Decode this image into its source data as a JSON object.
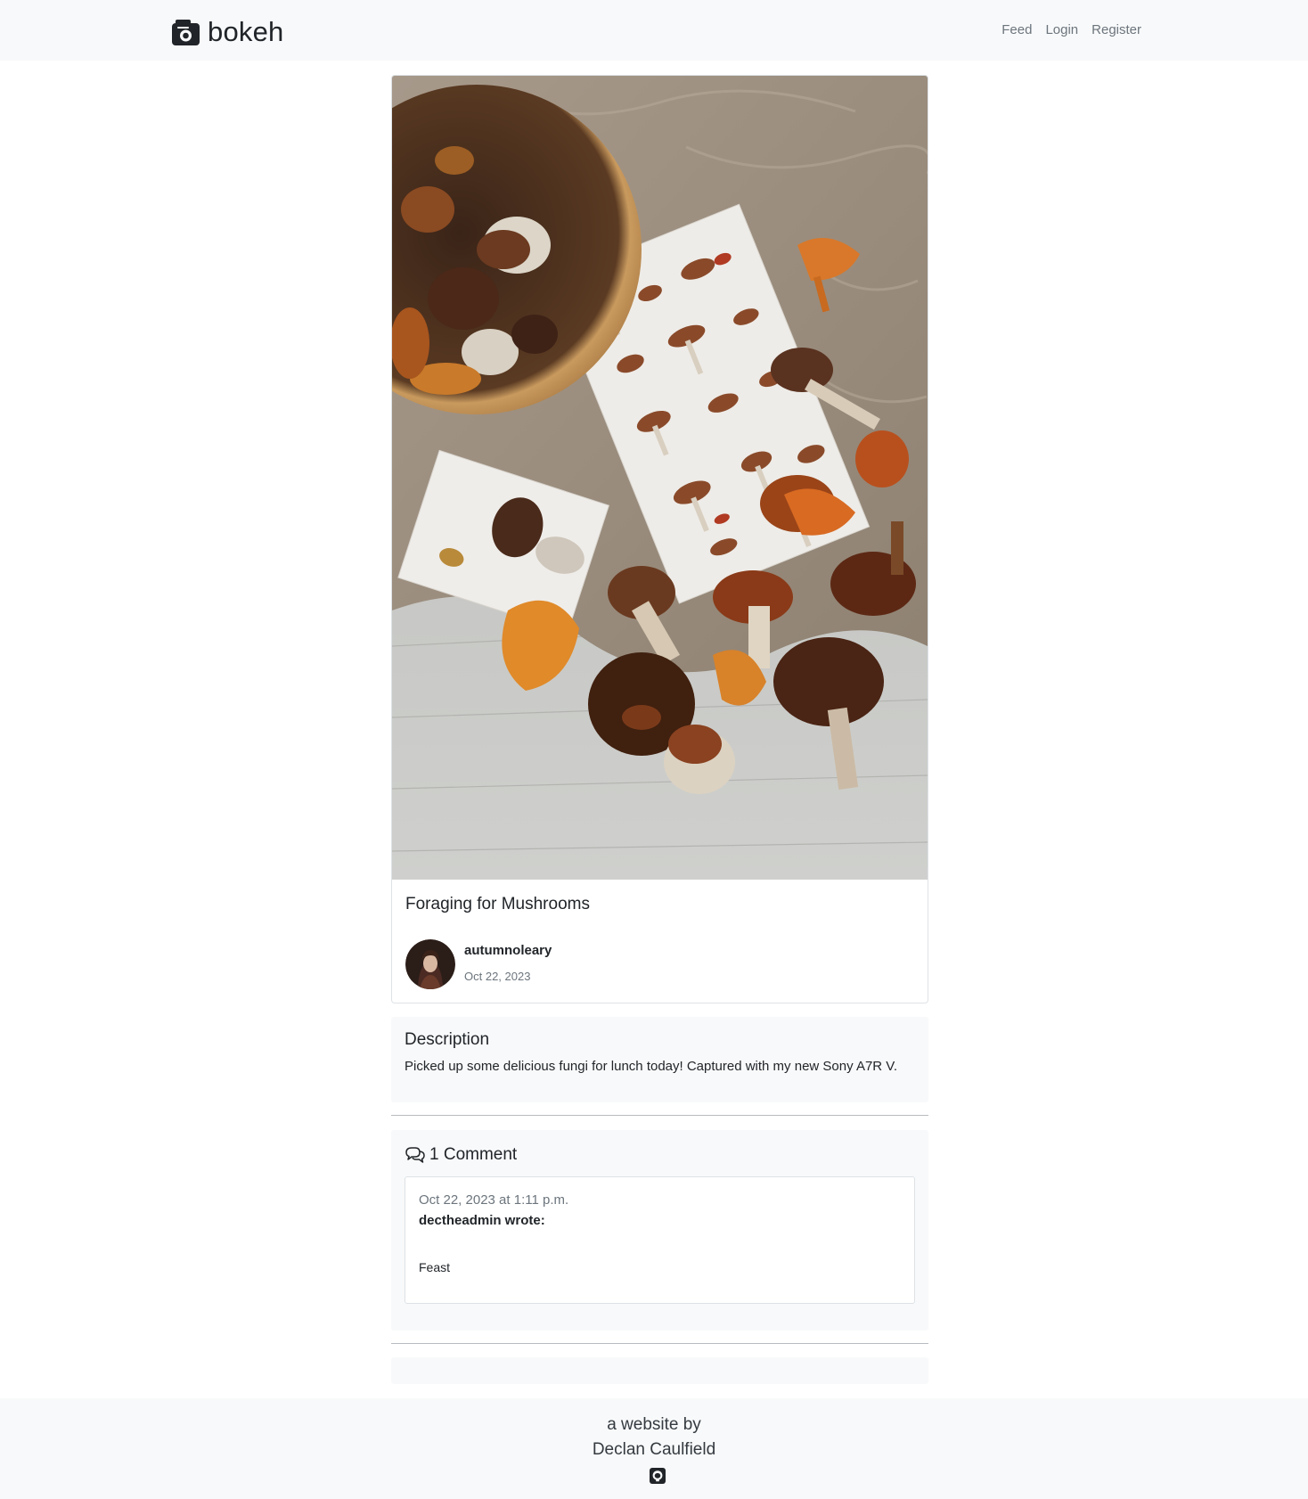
{
  "navbar": {
    "brand": "bokeh",
    "links": [
      "Feed",
      "Login",
      "Register"
    ]
  },
  "post": {
    "image_alt": "Mushrooms in a wicker basket and field guide cards on a knit blanket",
    "title": "Foraging for Mushrooms",
    "author": "autumnoleary",
    "date": "Oct 22, 2023"
  },
  "description": {
    "heading": "Description",
    "text": "Picked up some delicious fungi for lunch today! Captured with my new Sony A7R V."
  },
  "comments": {
    "title": "1 Comment",
    "items": [
      {
        "date": "Oct 22, 2023 at 1:11 p.m.",
        "author_line": "dectheadmin wrote:",
        "text": "Feast"
      }
    ]
  },
  "footer": {
    "line1": "a website by",
    "line2": "Declan Caulfield"
  },
  "colors": {
    "panel_bg": "#f8f9fa",
    "text": "#212529",
    "muted": "#6c757d"
  }
}
